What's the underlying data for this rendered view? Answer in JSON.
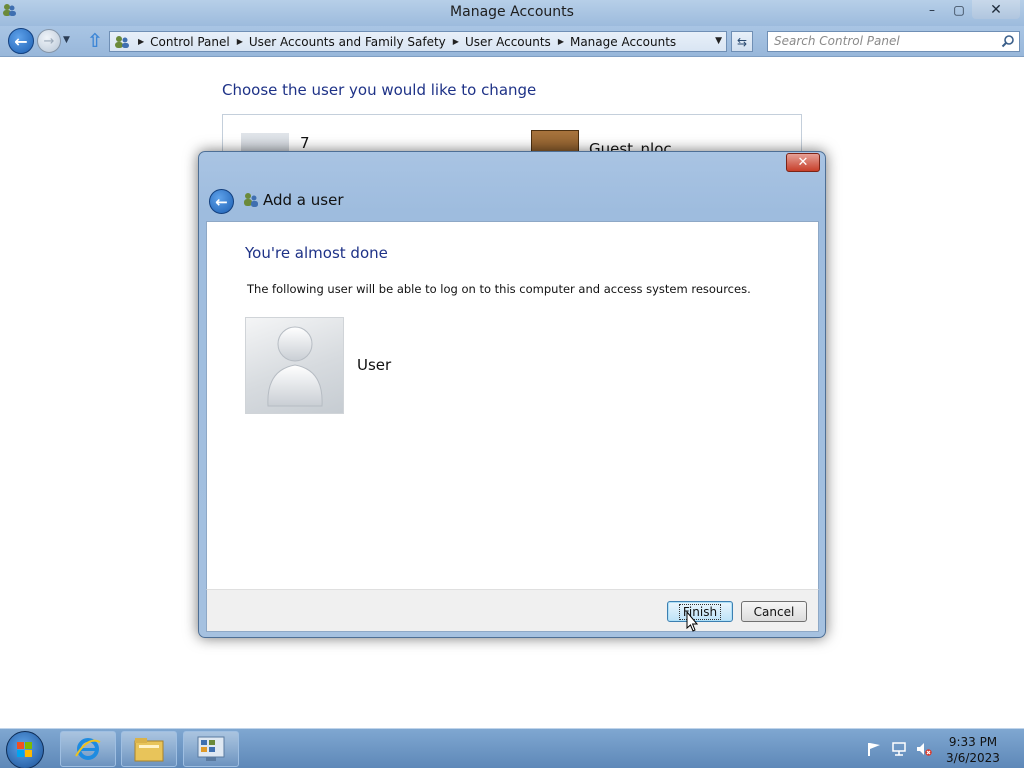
{
  "window": {
    "title": "Manage Accounts",
    "controls": {
      "minimize": "–",
      "maximize": "▢",
      "close": "✕"
    }
  },
  "navigation": {
    "back_icon": "back-arrow-icon",
    "forward_icon": "forward-arrow-icon",
    "breadcrumbs": [
      "Control Panel",
      "User Accounts and Family Safety",
      "User Accounts",
      "Manage Accounts"
    ],
    "search_placeholder": "Search Control Panel"
  },
  "main": {
    "heading": "Choose the user you would like to change",
    "accounts": [
      {
        "name": "7",
        "tile_icon": "default-user-tile-icon"
      },
      {
        "name": "Guest_nloc",
        "tile_icon": "briefcase-user-tile-icon"
      }
    ]
  },
  "dialog": {
    "title": "Add a user",
    "close_label": "✕",
    "heading": "You're almost done",
    "description": "The following user will be able to log on to this computer and access system resources.",
    "user_name": "User",
    "finish_label": "Finish",
    "cancel_label": "Cancel"
  },
  "taskbar": {
    "pinned": [
      "internet-explorer-icon",
      "file-explorer-icon",
      "control-panel-icon"
    ],
    "tray_icons": [
      "flag-icon",
      "network-icon",
      "volume-muted-icon"
    ],
    "time": "9:33 PM",
    "date": "3/6/2023"
  },
  "colors": {
    "heading_blue": "#1e3287",
    "chrome_blue": "#a9c5e4",
    "taskbar_blue": "#6b93c2"
  }
}
